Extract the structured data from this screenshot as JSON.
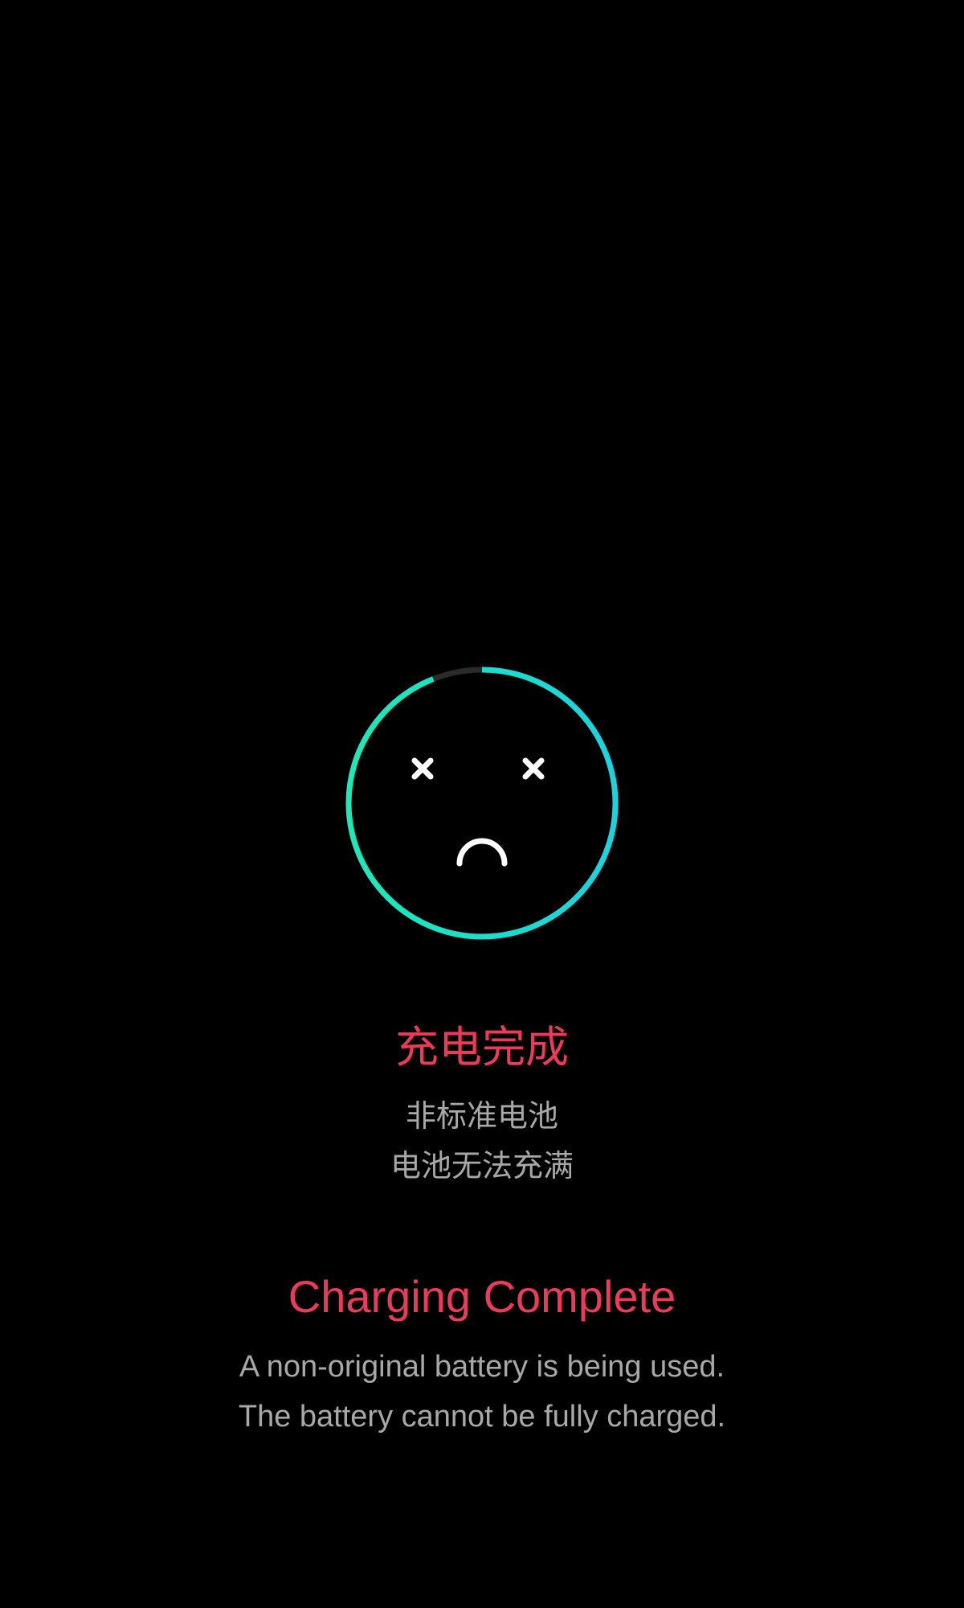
{
  "colors": {
    "background": "#000000",
    "title": "#ec3b5a",
    "body_text": "#a8a8a8",
    "ring_start": "#1de9b6",
    "ring_end": "#1ad3e0",
    "ring_track": "#2a2a2a",
    "face": "#ffffff"
  },
  "charge_ring": {
    "progress_fraction": 0.94
  },
  "face": {
    "left_eye_icon": "x-mark-icon",
    "right_eye_icon": "x-mark-icon",
    "mouth_icon": "frown-arc-icon"
  },
  "message_cn": {
    "title": "充电完成",
    "line1": "非标准电池",
    "line2": "电池无法充满"
  },
  "message_en": {
    "title": "Charging Complete",
    "line1": "A non-original battery is being used.",
    "line2": "The battery cannot be fully charged."
  }
}
